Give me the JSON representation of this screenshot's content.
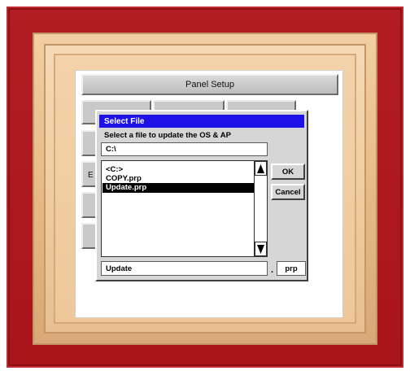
{
  "panel": {
    "header_label": "Panel Setup",
    "obscured_label_letter": "E"
  },
  "dialog": {
    "title": "Select File",
    "prompt": "Select a file to update the OS & AP",
    "path": "C:\\",
    "files": [
      {
        "name": "<C:>",
        "selected": false
      },
      {
        "name": "COPY.prp",
        "selected": false
      },
      {
        "name": "Update.prp",
        "selected": true
      }
    ],
    "ok_label": "OK",
    "cancel_label": "Cancel",
    "filename_value": "Update",
    "ext_separator": ".",
    "extension": "prp",
    "scroll_up_icon": "triangle-up-icon",
    "scroll_down_icon": "triangle-down-icon"
  },
  "colors": {
    "titlebar": "#1f12e6",
    "frame_red": "#b11d22",
    "frame_gold": "#f0cda0",
    "selection": "#000000"
  }
}
